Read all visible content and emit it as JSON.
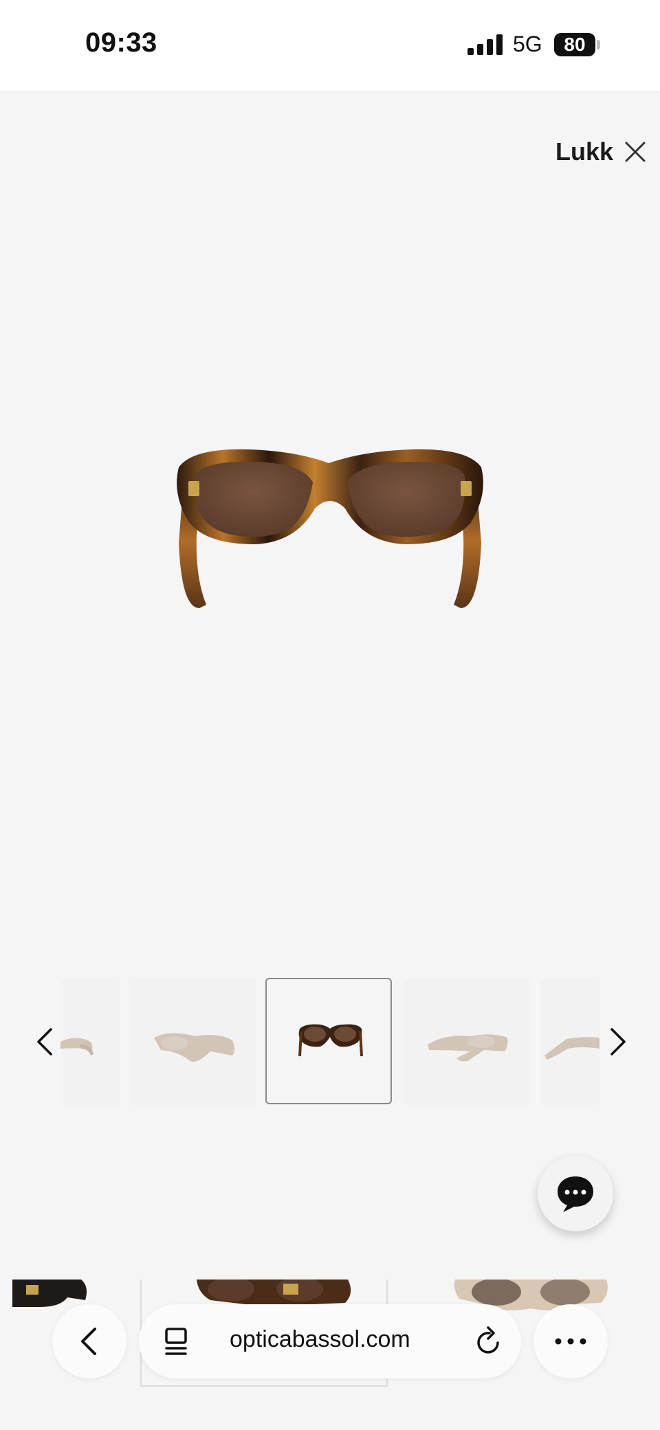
{
  "status_bar": {
    "time": "09:33",
    "network": "5G",
    "battery": "80"
  },
  "viewer": {
    "close_label": "Lukk"
  },
  "thumbnails": {
    "count": 5,
    "active_index": 2
  },
  "browser": {
    "url": "opticabassol.com"
  },
  "icons": {
    "close": "close-icon",
    "prev": "chevron-left-icon",
    "next": "chevron-right-icon",
    "chat": "chat-bubble-icon",
    "back": "back-icon",
    "reader": "reader-icon",
    "reload": "reload-icon",
    "more": "more-icon"
  },
  "colors": {
    "background": "#f5f5f5",
    "tortoise_dark": "#3a2418",
    "tortoise_light": "#c0782a",
    "lens": "#6b4a36"
  }
}
